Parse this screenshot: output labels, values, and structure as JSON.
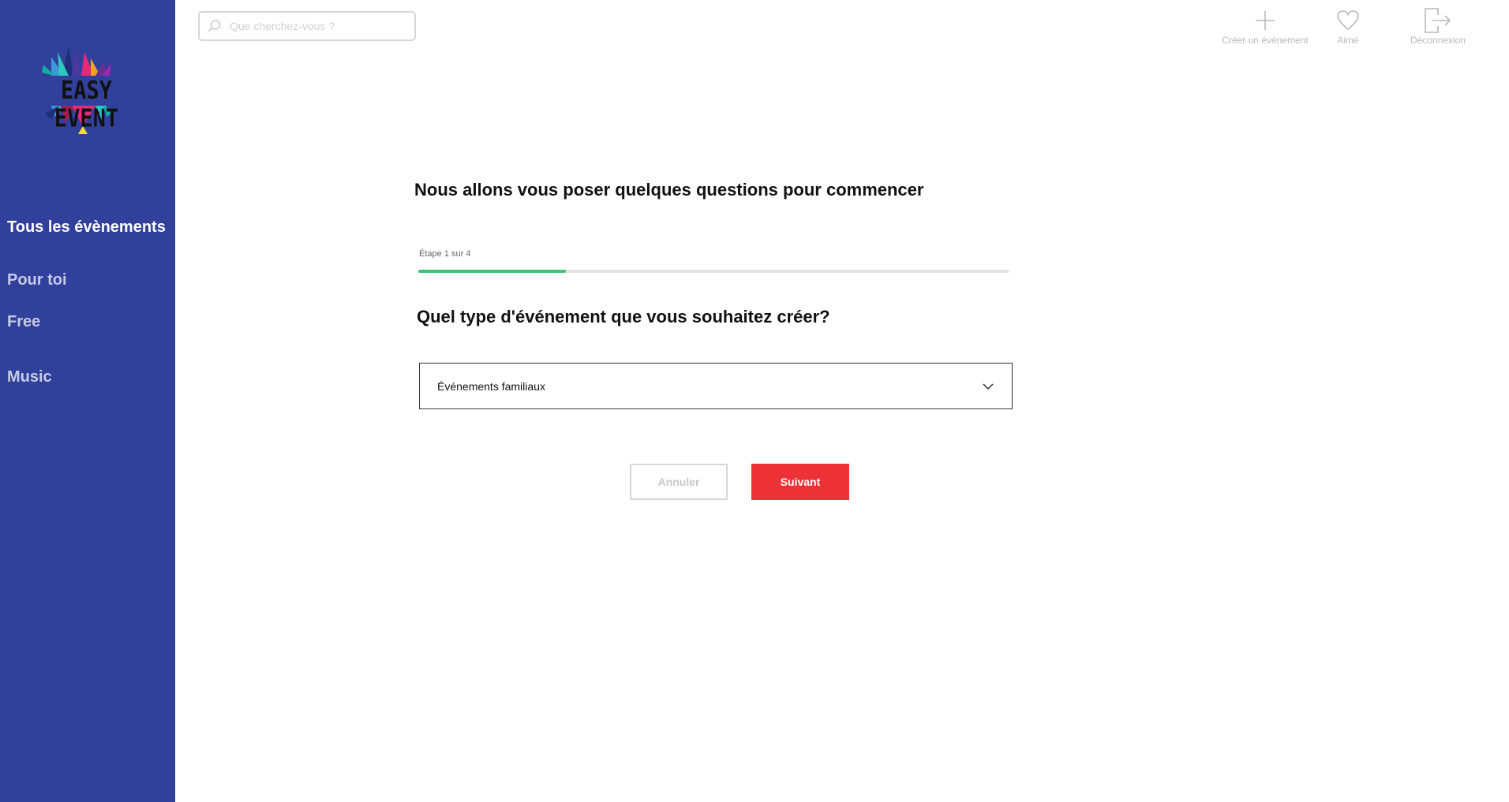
{
  "brand": {
    "logo_text": "EASY EVENT"
  },
  "sidebar": {
    "items": [
      {
        "label": "Tous les évènements",
        "active": true
      },
      {
        "label": "Pour toi",
        "active": false
      },
      {
        "label": "Free",
        "active": false
      },
      {
        "label": "Music",
        "active": false
      }
    ]
  },
  "search": {
    "placeholder": "Que cherchez-vous ?"
  },
  "top_actions": {
    "create_label": "Créer un évènement",
    "liked_label": "Aimé",
    "logout_label": "Déconnexion"
  },
  "wizard": {
    "intro": "Nous allons vous poser quelques questions pour commencer",
    "step_label": "Étape 1 sur 4",
    "step_current": 1,
    "step_total": 4,
    "progress_fraction": 0.25,
    "question": "Quel type d'événement que vous souhaitez créer?",
    "selected_value": "Événements familiaux",
    "cancel_label": "Annuler",
    "next_label": "Suivant"
  },
  "colors": {
    "sidebar_bg": "#31409b",
    "progress": "#3dc275",
    "primary_button": "#ed3237"
  }
}
